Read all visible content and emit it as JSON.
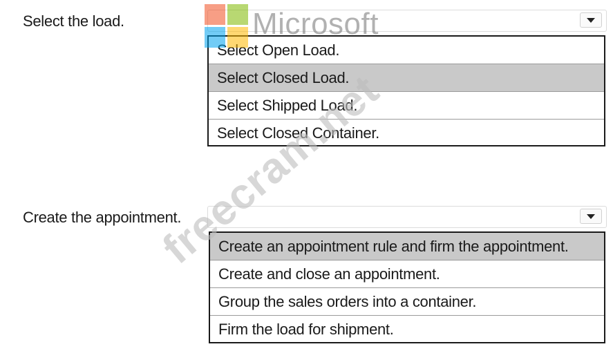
{
  "watermark": {
    "logo_text": "Microsoft",
    "site_text": "freecram.net",
    "colors": {
      "red": "#f25022",
      "green": "#7fba00",
      "blue": "#00a4ef",
      "yellow": "#ffb900"
    }
  },
  "questions": [
    {
      "label": "Select the load.",
      "selected_value": "",
      "options": [
        "Select Open Load.",
        "Select Closed Load.",
        "Select Shipped Load.",
        "Select Closed Container."
      ],
      "highlighted_option": "Select Closed Load."
    },
    {
      "label": "Create the appointment.",
      "selected_value": "",
      "options": [
        "Create an appointment rule and firm the appointment.",
        "Create and close an appointment.",
        "Group the sales orders into a container.",
        "Firm the load for shipment."
      ],
      "highlighted_option": "Create an appointment rule and firm the appointment."
    }
  ]
}
